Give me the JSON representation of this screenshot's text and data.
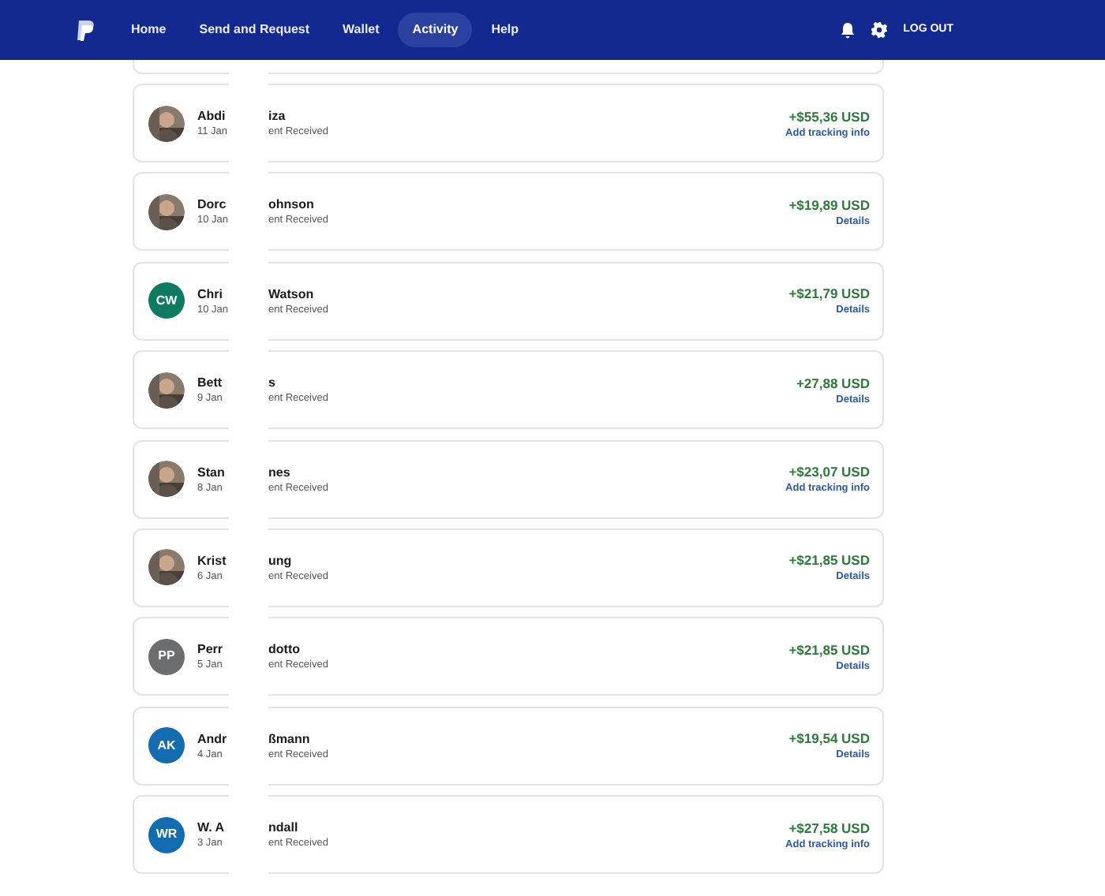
{
  "nav": {
    "items": [
      {
        "label": "Home",
        "selected": false
      },
      {
        "label": "Send and Request",
        "selected": false
      },
      {
        "label": "Wallet",
        "selected": false
      },
      {
        "label": "Activity",
        "selected": true
      },
      {
        "label": "Help",
        "selected": false
      }
    ],
    "logout": "LOG OUT"
  },
  "transactions": [
    {
      "name_start": "Abdi",
      "name_end": "iza",
      "date": "11 Jan",
      "type_end": "ent Received",
      "amount": "+$55,36 USD",
      "link": "Add tracking info"
    },
    {
      "name_start": "Dorc",
      "name_end": "ohnson",
      "date": "10 Jan",
      "type_end": "ent Received",
      "amount": "+$19,89 USD",
      "link": "Details"
    },
    {
      "avatar": {
        "kind": "initials",
        "initials": "CW",
        "color": "#0e7a5f"
      },
      "name_start": "Chri",
      "name_end": "Watson",
      "date": "10 Jan",
      "type_end": "ent Received",
      "amount": "+$21,79 USD",
      "link": "Details"
    },
    {
      "name_start": "Bett",
      "name_end": "s",
      "date": "9 Jan",
      "type_end": "ent Received",
      "amount": "+27,88 USD",
      "link": "Details"
    },
    {
      "name_start": "Stan",
      "name_end": "nes",
      "date": "8 Jan",
      "type_end": "ent Received",
      "amount": "+$23,07 USD",
      "link": "Add tracking info"
    },
    {
      "name_start": "Krist",
      "name_end": "ung",
      "date": "6 Jan",
      "type_end": "ent Received",
      "amount": "+$21,85 USD",
      "link": "Details"
    },
    {
      "avatar": {
        "kind": "initials",
        "initials": "PP",
        "color": "#6b6e70"
      },
      "name_start": "Perr",
      "name_end": "dotto",
      "date": "5 Jan",
      "type_end": "ent Received",
      "amount": "+$21,85 USD",
      "link": "Details"
    },
    {
      "avatar": {
        "kind": "initials",
        "initials": "AK",
        "color": "#136bb0"
      },
      "name_start": "Andr",
      "name_end": "ßmann",
      "date": "4 Jan",
      "type_end": "ent Received",
      "amount": "+$19,54 USD",
      "link": "Details"
    },
    {
      "avatar": {
        "kind": "initials",
        "initials": "WR",
        "color": "#136bb0"
      },
      "name_start": "W. A",
      "name_end": "ndall",
      "date": "3 Jan",
      "type_end": "ent Received",
      "amount": "+$27,58 USD",
      "link": "Add tracking info"
    }
  ]
}
